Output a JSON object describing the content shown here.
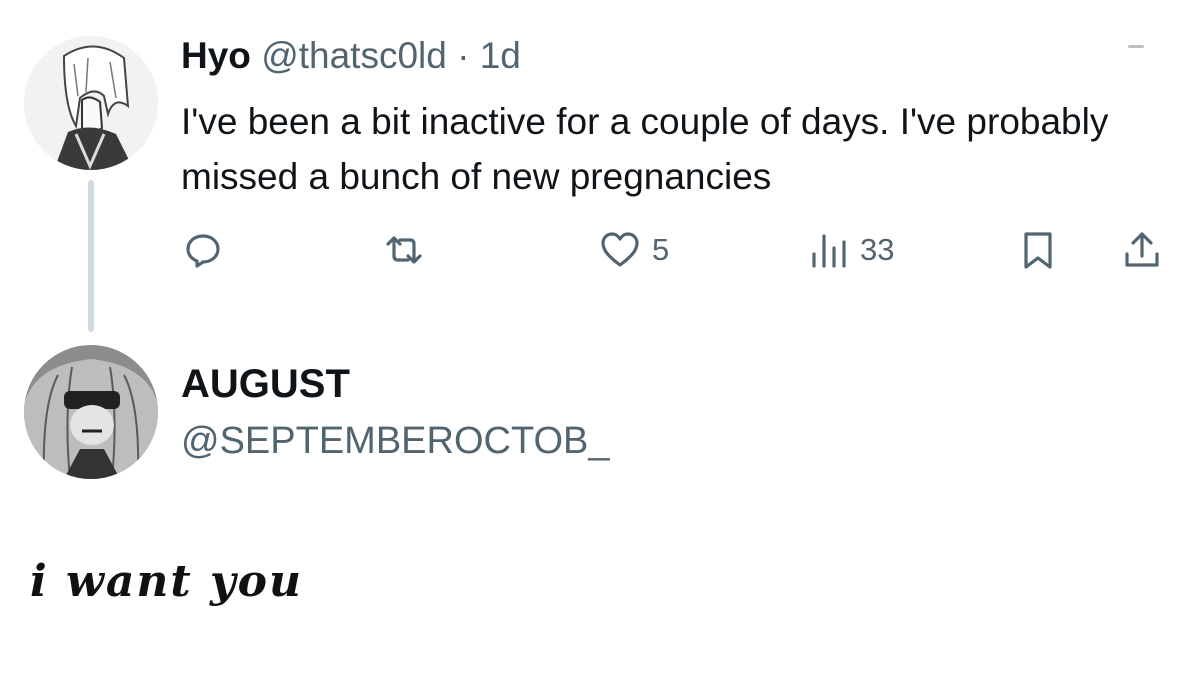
{
  "tweet": {
    "display_name": "Hyo",
    "handle": "@thatsc0ld",
    "separator": "·",
    "time": "1d",
    "text": "I've been a bit inactive for a couple of days. I've probably missed a bunch of new pregnancies",
    "actions": {
      "reply_icon": "reply-icon",
      "retweet_icon": "retweet-icon",
      "like_icon": "heart-icon",
      "like_count": "5",
      "views_icon": "views-icon",
      "views_count": "33",
      "bookmark_icon": "bookmark-icon",
      "share_icon": "share-icon"
    }
  },
  "reply_user": {
    "display_name": "AUGUST",
    "handle": "@SEPTEMBEROCTOB_"
  },
  "caption": "i want you",
  "colors": {
    "text_primary": "#0f1419",
    "text_secondary": "#536471",
    "thread_line": "#cfd9de",
    "background": "#ffffff"
  }
}
